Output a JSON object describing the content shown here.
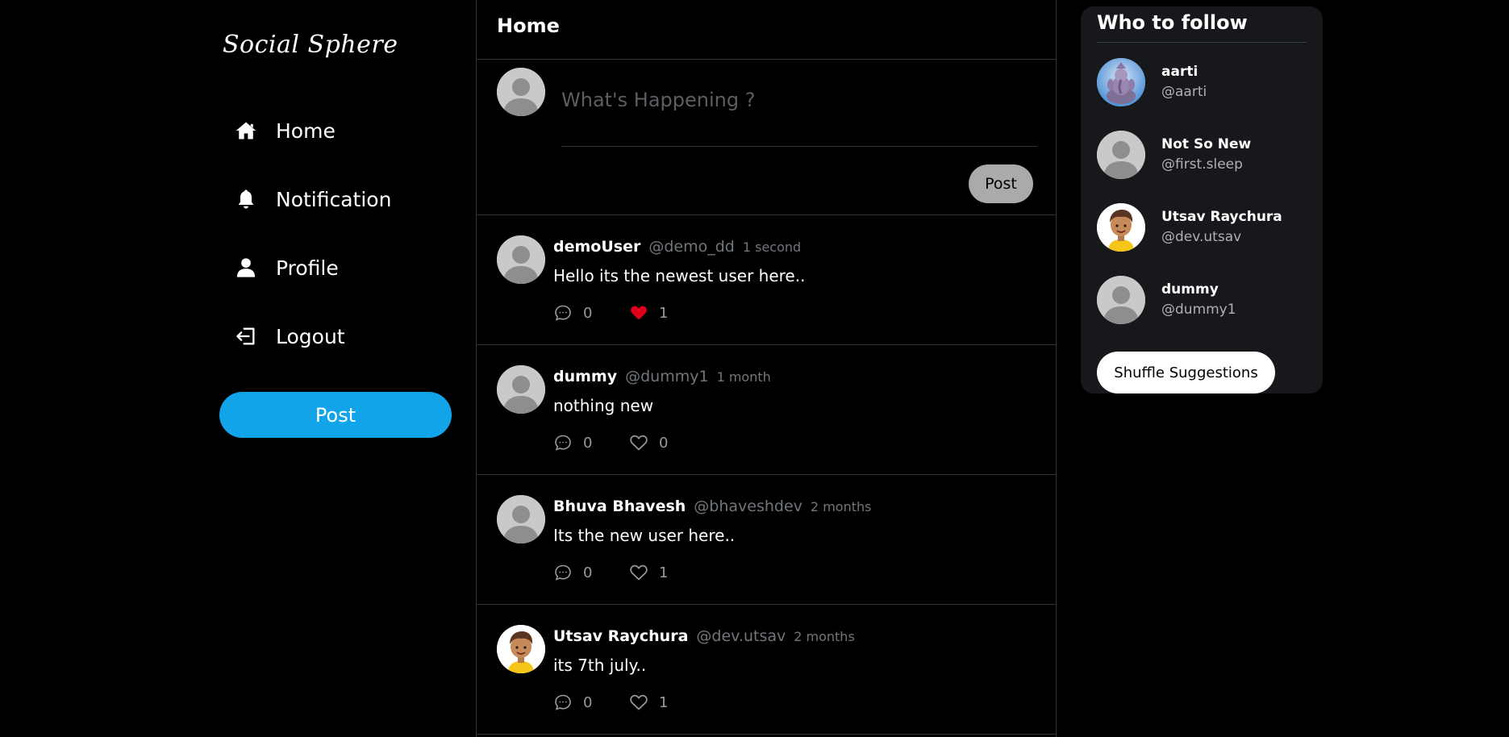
{
  "brand": {
    "logo_text": "Social Sphere"
  },
  "sidebar": {
    "items": [
      {
        "label": "Home",
        "icon": "home-icon"
      },
      {
        "label": "Notification",
        "icon": "bell-icon"
      },
      {
        "label": "Profile",
        "icon": "user-icon"
      },
      {
        "label": "Logout",
        "icon": "logout-icon"
      }
    ],
    "post_button": "Post"
  },
  "feed": {
    "title": "Home",
    "composer": {
      "placeholder": "What's Happening ?",
      "post_button": "Post"
    },
    "posts": [
      {
        "name": "demoUser",
        "handle": "@demo_dd",
        "time": "1 second",
        "text": "Hello its the newest user here..",
        "comments": "0",
        "likes": "1",
        "liked": true,
        "avatar": "default-avatar"
      },
      {
        "name": "dummy",
        "handle": "@dummy1",
        "time": "1 month",
        "text": "nothing new",
        "comments": "0",
        "likes": "0",
        "liked": false,
        "avatar": "default-avatar"
      },
      {
        "name": "Bhuva Bhavesh",
        "handle": "@bhaveshdev",
        "time": "2 months",
        "text": "Its the new user here..",
        "comments": "0",
        "likes": "1",
        "liked": false,
        "avatar": "default-avatar"
      },
      {
        "name": "Utsav Raychura",
        "handle": "@dev.utsav",
        "time": "2 months",
        "text": "its 7th july..",
        "comments": "0",
        "likes": "1",
        "liked": false,
        "avatar": "cartoon-boy-avatar"
      }
    ]
  },
  "who_to_follow": {
    "title": "Who to follow",
    "users": [
      {
        "name": "aarti",
        "handle": "@aarti",
        "avatar": "deity-photo-avatar"
      },
      {
        "name": "Not So New",
        "handle": "@first.sleep",
        "avatar": "default-avatar"
      },
      {
        "name": "Utsav Raychura",
        "handle": "@dev.utsav",
        "avatar": "cartoon-boy-avatar"
      },
      {
        "name": "dummy",
        "handle": "@dummy1",
        "avatar": "default-avatar"
      }
    ],
    "shuffle_button": "Shuffle Suggestions"
  },
  "colors": {
    "background": "#000000",
    "accent": "#12a4e8",
    "like_active": "#e0001b",
    "muted_text": "#71767b",
    "panel": "#16181c"
  }
}
